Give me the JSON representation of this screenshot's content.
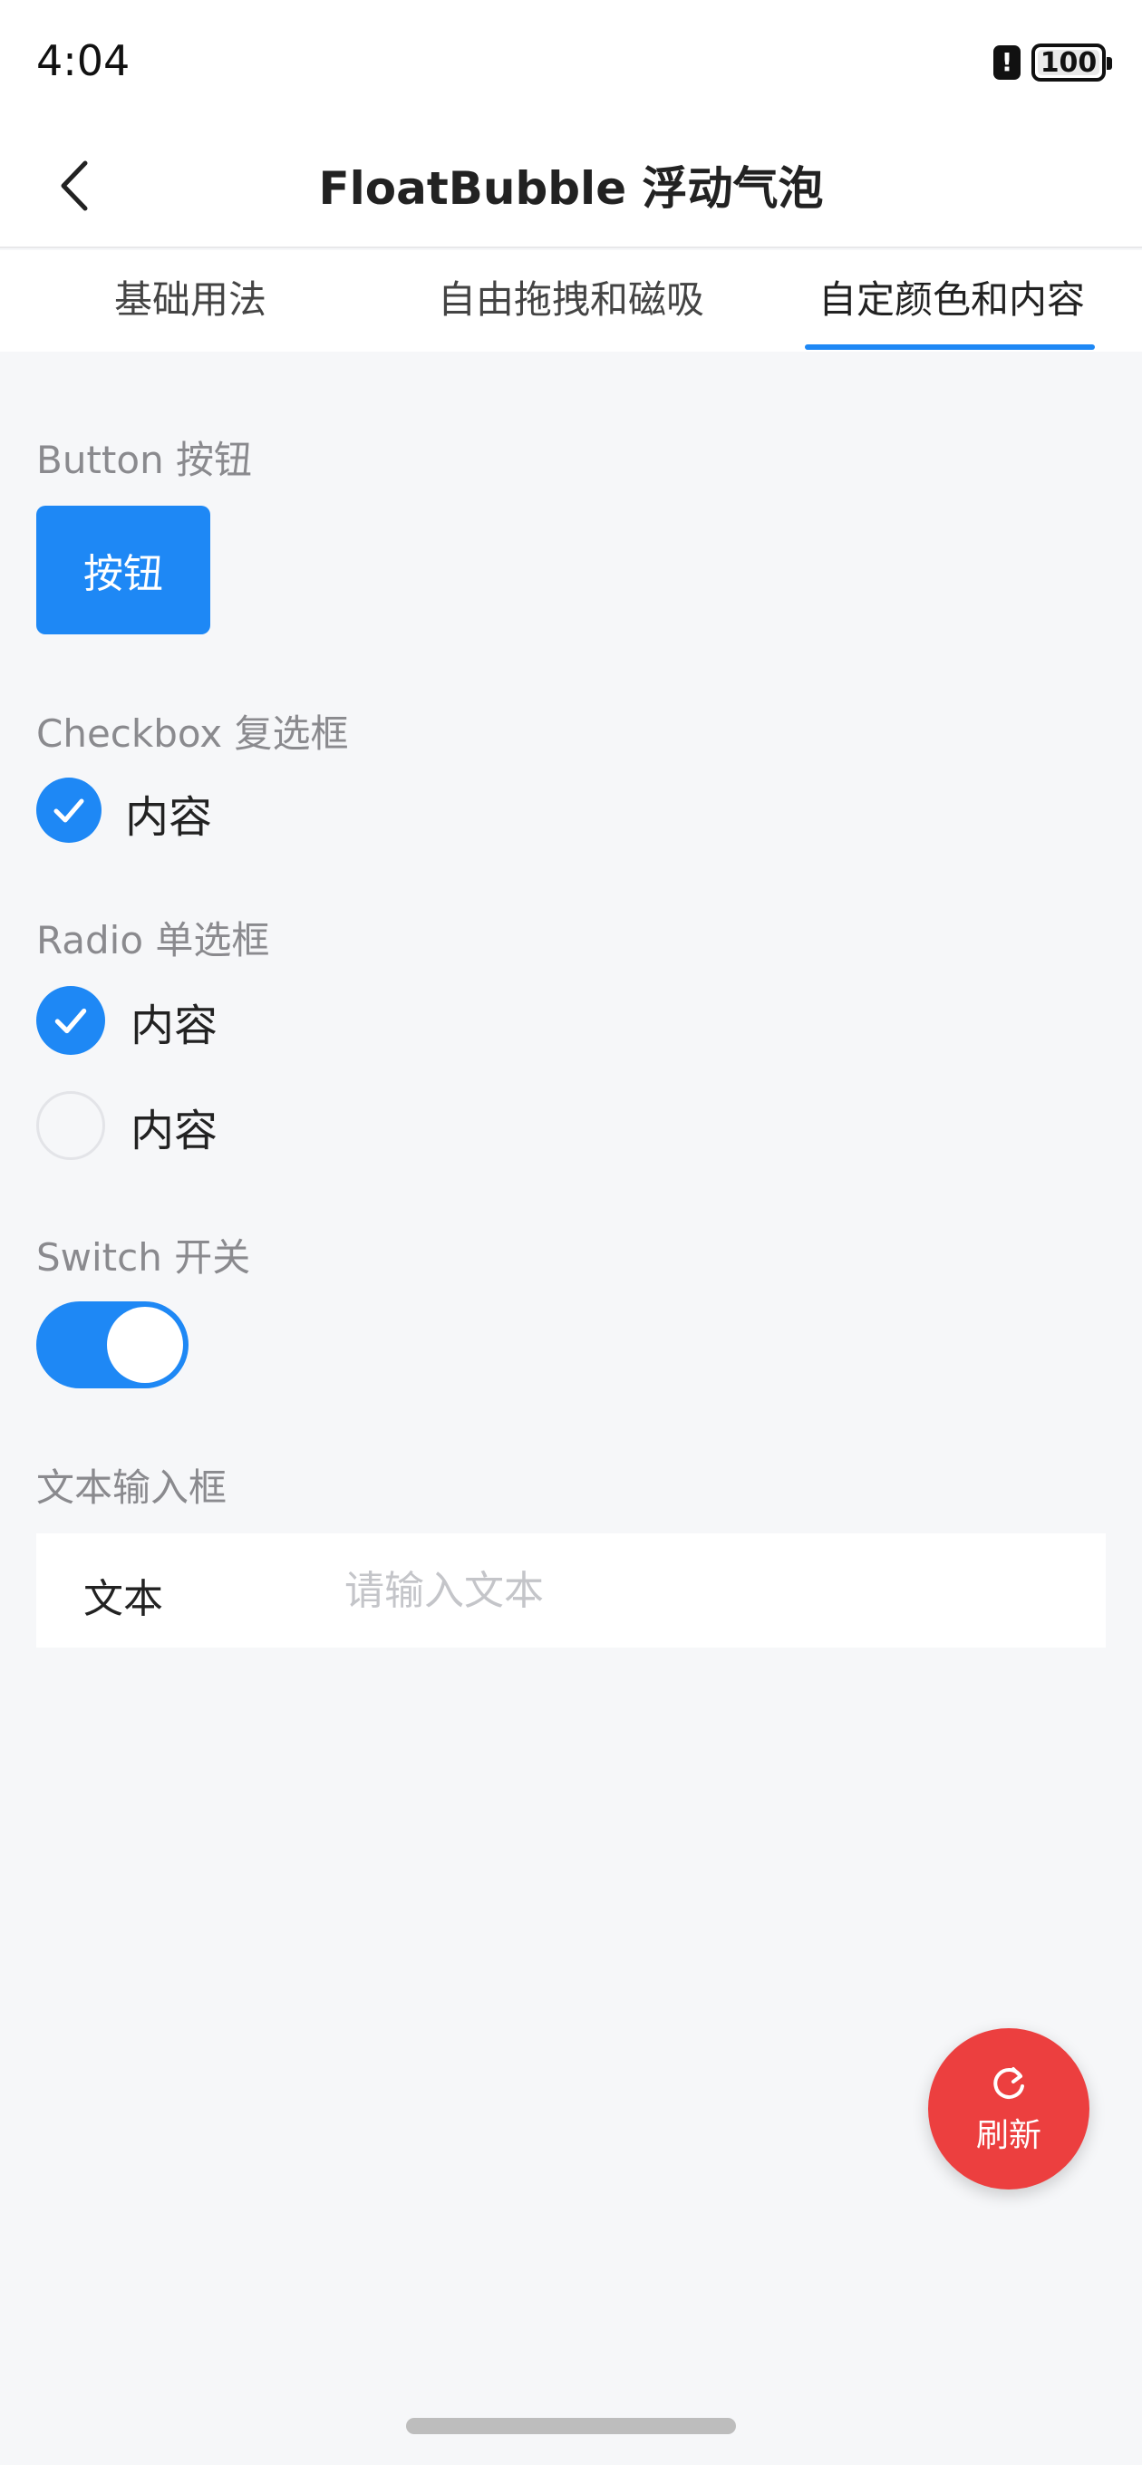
{
  "status_bar": {
    "time": "4:04",
    "battery": "100",
    "alert_symbol": "!"
  },
  "nav": {
    "title": "FloatBubble 浮动气泡",
    "back_icon": "chevron-left-icon"
  },
  "tabs": [
    {
      "label": "基础用法",
      "active": false
    },
    {
      "label": "自由拖拽和磁吸",
      "active": false
    },
    {
      "label": "自定颜色和内容",
      "active": true
    }
  ],
  "sections": {
    "button": {
      "label": "Button 按钮",
      "button_text": "按钮"
    },
    "checkbox": {
      "label": "Checkbox 复选框",
      "option": "内容",
      "checked": true
    },
    "radio": {
      "label": "Radio 单选框",
      "options": [
        {
          "label": "内容",
          "checked": true
        },
        {
          "label": "内容",
          "checked": false
        }
      ]
    },
    "switch": {
      "label": "Switch 开关",
      "on": true
    },
    "text_input": {
      "label": "文本输入框",
      "field_label": "文本",
      "value": "",
      "placeholder": "请输入文本"
    }
  },
  "float_bubble": {
    "label": "刷新",
    "icon": "refresh-icon"
  },
  "colors": {
    "primary": "#1e88f5",
    "bubble": "#ec3f3f",
    "background": "#f6f7f9",
    "section_label": "#8a8a8e"
  }
}
